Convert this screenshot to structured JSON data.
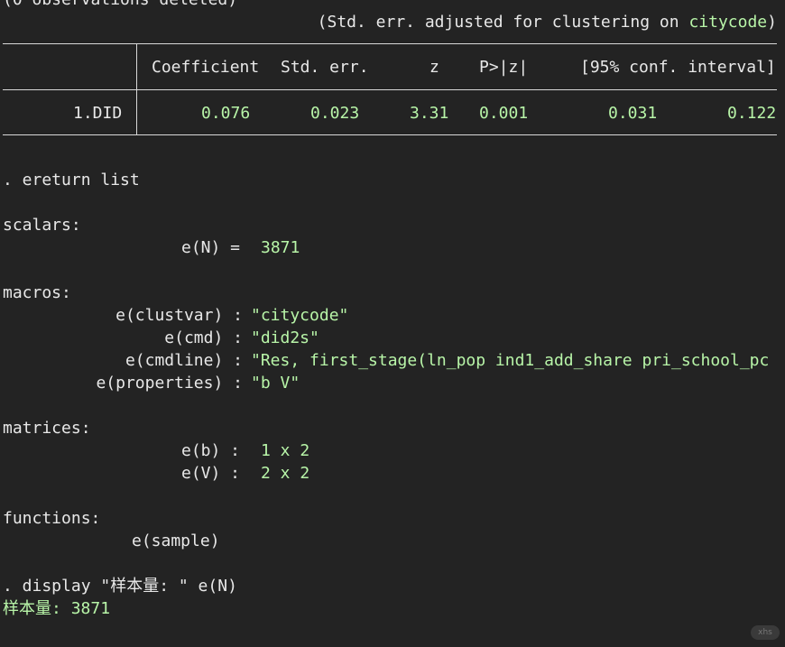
{
  "top": {
    "deleted_line": "(0 observations deleted)",
    "se_note_prefix": "(Std. err. adjusted for clustering on ",
    "se_note_var": "citycode",
    "se_note_suffix": ")"
  },
  "table": {
    "headers": [
      "Coefficient",
      "Std. err.",
      "z",
      "P>|z|",
      "[95% conf. interval]"
    ],
    "row": {
      "label": "1.DID",
      "coef": "0.076",
      "se": "0.023",
      "z": "3.31",
      "p": "0.001",
      "ci_low": "0.031",
      "ci_high": "0.122"
    }
  },
  "commands": {
    "ereturn": ". ereturn list",
    "display": ". display \"样本量: \" e(N)"
  },
  "scalars": {
    "header": "scalars:",
    "n_label": "e(N) =",
    "n_value": "3871"
  },
  "macros": {
    "header": "macros:",
    "items": [
      {
        "key": "e(clustvar) :",
        "value": "\"citycode\""
      },
      {
        "key": "e(cmd) :",
        "value": "\"did2s\""
      },
      {
        "key": "e(cmdline) :",
        "value": "\"Res, first_stage(ln_pop ind1_add_share pri_school_pc"
      },
      {
        "key": "e(properties) :",
        "value": "\"b V\""
      }
    ]
  },
  "matrices": {
    "header": "matrices:",
    "items": [
      {
        "key": "e(b) :",
        "value": "1 x 2"
      },
      {
        "key": "e(V) :",
        "value": "2 x 2"
      }
    ]
  },
  "functions": {
    "header": "functions:",
    "item": "e(sample)"
  },
  "result": {
    "label": "样本量:",
    "value": "3871"
  },
  "watermark": "xhs"
}
